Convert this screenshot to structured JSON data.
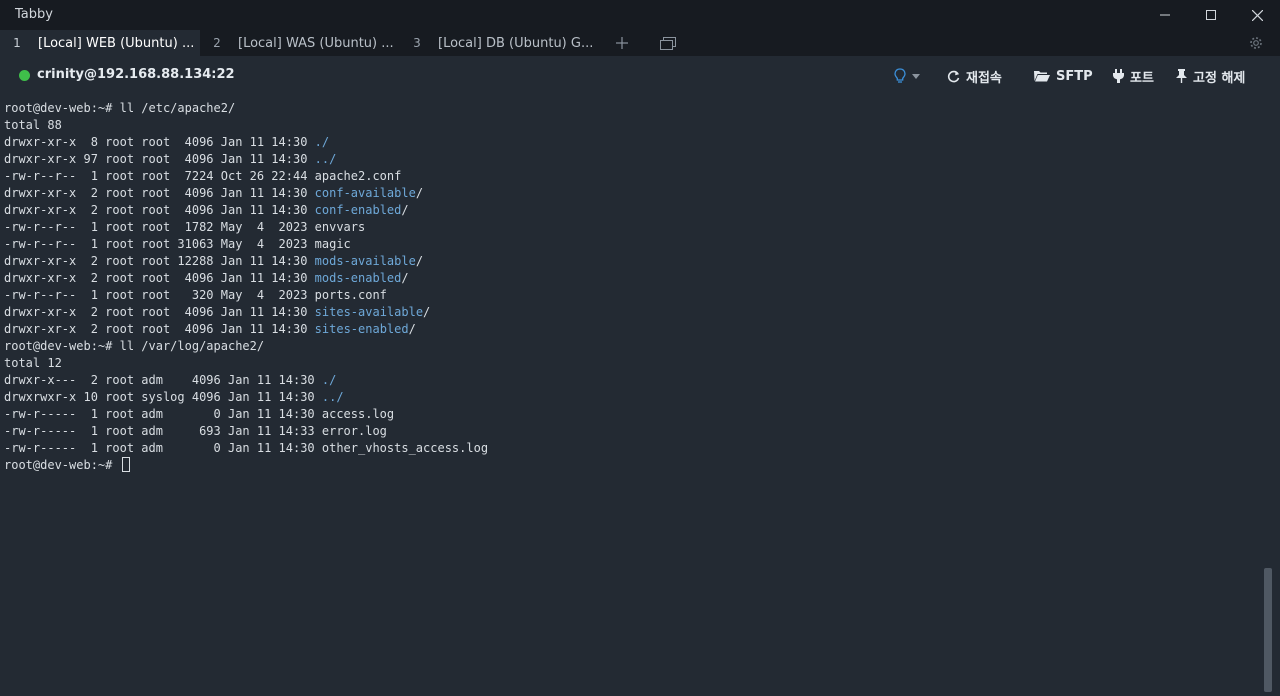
{
  "app": {
    "title": "Tabby"
  },
  "tabs": [
    {
      "num": "1",
      "title": "[Local] WEB (Ubuntu) ...",
      "active": true
    },
    {
      "num": "2",
      "title": "[Local] WAS (Ubuntu) ...",
      "active": false
    },
    {
      "num": "3",
      "title": "[Local] DB (Ubuntu) G...",
      "active": false
    }
  ],
  "toolbar": {
    "host": "crinity@192.168.88.134:22",
    "reconnect_label": "재접속",
    "sftp_label": "SFTP",
    "ports_label": "포트",
    "pin_label": "고정 해제"
  },
  "colors": {
    "connected": "#3fbf4a",
    "accent": "#3b8fd9",
    "dir": "#6ea8d8"
  },
  "terminal": {
    "lines": [
      [
        {
          "t": "root@dev-web:~# ll /etc/apache2/"
        }
      ],
      [
        {
          "t": "total 88"
        }
      ],
      [
        {
          "t": "drwxr-xr-x  8 root root  4096 Jan 11 14:30 "
        },
        {
          "t": "./",
          "c": "blue"
        }
      ],
      [
        {
          "t": "drwxr-xr-x 97 root root  4096 Jan 11 14:30 "
        },
        {
          "t": "../",
          "c": "blue"
        }
      ],
      [
        {
          "t": "-rw-r--r--  1 root root  7224 Oct 26 22:44 apache2.conf"
        }
      ],
      [
        {
          "t": "drwxr-xr-x  2 root root  4096 Jan 11 14:30 "
        },
        {
          "t": "conf-available",
          "c": "blue"
        },
        {
          "t": "/"
        }
      ],
      [
        {
          "t": "drwxr-xr-x  2 root root  4096 Jan 11 14:30 "
        },
        {
          "t": "conf-enabled",
          "c": "blue"
        },
        {
          "t": "/"
        }
      ],
      [
        {
          "t": "-rw-r--r--  1 root root  1782 May  4  2023 envvars"
        }
      ],
      [
        {
          "t": "-rw-r--r--  1 root root 31063 May  4  2023 magic"
        }
      ],
      [
        {
          "t": "drwxr-xr-x  2 root root 12288 Jan 11 14:30 "
        },
        {
          "t": "mods-available",
          "c": "blue"
        },
        {
          "t": "/"
        }
      ],
      [
        {
          "t": "drwxr-xr-x  2 root root  4096 Jan 11 14:30 "
        },
        {
          "t": "mods-enabled",
          "c": "blue"
        },
        {
          "t": "/"
        }
      ],
      [
        {
          "t": "-rw-r--r--  1 root root   320 May  4  2023 ports.conf"
        }
      ],
      [
        {
          "t": "drwxr-xr-x  2 root root  4096 Jan 11 14:30 "
        },
        {
          "t": "sites-available",
          "c": "blue"
        },
        {
          "t": "/"
        }
      ],
      [
        {
          "t": "drwxr-xr-x  2 root root  4096 Jan 11 14:30 "
        },
        {
          "t": "sites-enabled",
          "c": "blue"
        },
        {
          "t": "/"
        }
      ],
      [
        {
          "t": "root@dev-web:~# ll /var/log/apache2/"
        }
      ],
      [
        {
          "t": "total 12"
        }
      ],
      [
        {
          "t": "drwxr-x---  2 root adm    4096 Jan 11 14:30 "
        },
        {
          "t": "./",
          "c": "blue"
        }
      ],
      [
        {
          "t": "drwxrwxr-x 10 root syslog 4096 Jan 11 14:30 "
        },
        {
          "t": "../",
          "c": "blue"
        }
      ],
      [
        {
          "t": "-rw-r-----  1 root adm       0 Jan 11 14:30 access.log"
        }
      ],
      [
        {
          "t": "-rw-r-----  1 root adm     693 Jan 11 14:33 error.log"
        }
      ],
      [
        {
          "t": "-rw-r-----  1 root adm       0 Jan 11 14:30 other_vhosts_access.log"
        }
      ],
      [
        {
          "t": "root@dev-web:~# "
        },
        {
          "cursor": true
        }
      ]
    ]
  }
}
